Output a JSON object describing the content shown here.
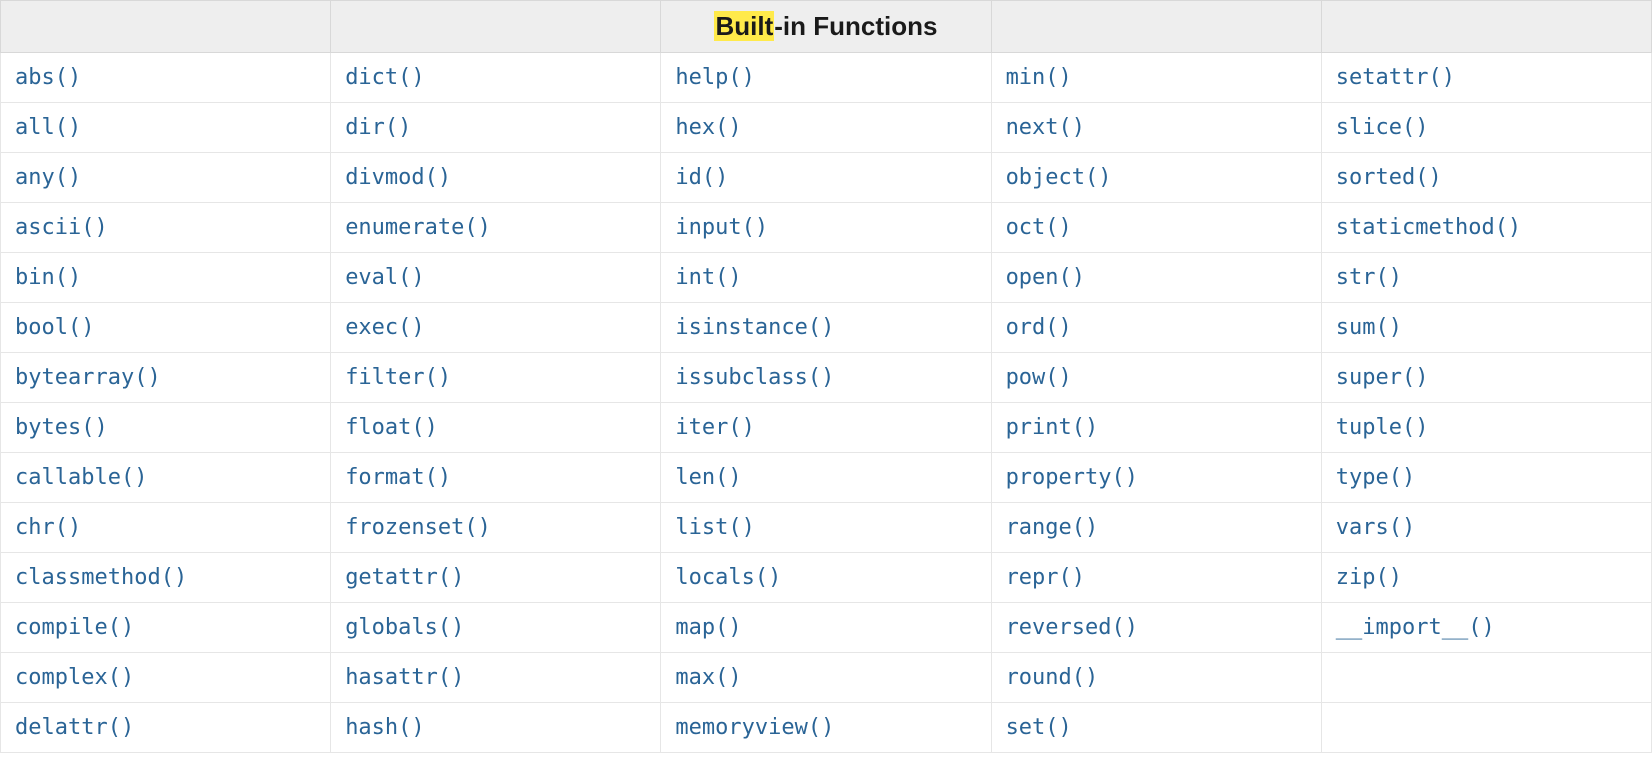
{
  "header": {
    "title_highlight": "Built",
    "title_rest": "-in Functions"
  },
  "columns": [
    [
      "abs()",
      "all()",
      "any()",
      "ascii()",
      "bin()",
      "bool()",
      "bytearray()",
      "bytes()",
      "callable()",
      "chr()",
      "classmethod()",
      "compile()",
      "complex()",
      "delattr()"
    ],
    [
      "dict()",
      "dir()",
      "divmod()",
      "enumerate()",
      "eval()",
      "exec()",
      "filter()",
      "float()",
      "format()",
      "frozenset()",
      "getattr()",
      "globals()",
      "hasattr()",
      "hash()"
    ],
    [
      "help()",
      "hex()",
      "id()",
      "input()",
      "int()",
      "isinstance()",
      "issubclass()",
      "iter()",
      "len()",
      "list()",
      "locals()",
      "map()",
      "max()",
      "memoryview()"
    ],
    [
      "min()",
      "next()",
      "object()",
      "oct()",
      "open()",
      "ord()",
      "pow()",
      "print()",
      "property()",
      "range()",
      "repr()",
      "reversed()",
      "round()",
      "set()"
    ],
    [
      "setattr()",
      "slice()",
      "sorted()",
      "staticmethod()",
      "str()",
      "sum()",
      "super()",
      "tuple()",
      "type()",
      "vars()",
      "zip()",
      "__import__()",
      "",
      ""
    ]
  ]
}
